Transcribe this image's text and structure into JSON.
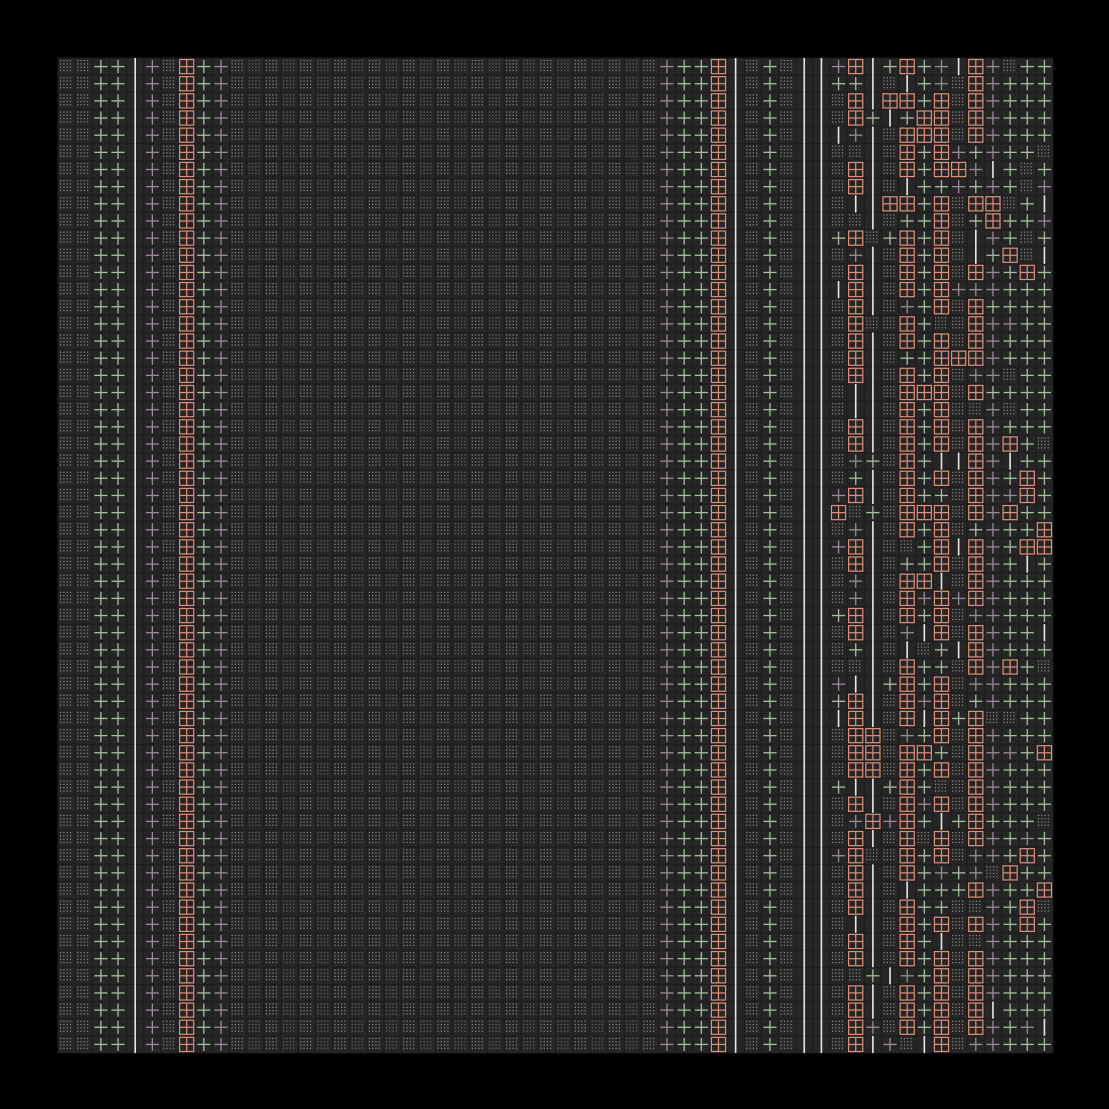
{
  "palette": {
    "background": "#000000",
    "panel": "#262626",
    "grid_line": "#1c1c1c",
    "dots": "#8e8e86",
    "dots_dim": "#6a6a64",
    "plus_green": "#a7bfa1",
    "plus_mauve": "#9b8a9b",
    "box_salmon": "#e0907c",
    "bar_white": "#e8e8e8"
  },
  "grid": {
    "columns": 58,
    "rows": 58,
    "column_kinds": "mdggwmsbgmddddddddddddddddddddddddddddddddddmggswzdwwbbwbgbm",
    "stripe_palette": [
      "dots",
      "dots",
      "plus_green",
      "plus_green",
      "bar_white",
      "plus_mauve",
      "dots",
      "box_salmon",
      "plus_green",
      "plus_mauve",
      "dots"
    ],
    "right_region_variation": true
  }
}
